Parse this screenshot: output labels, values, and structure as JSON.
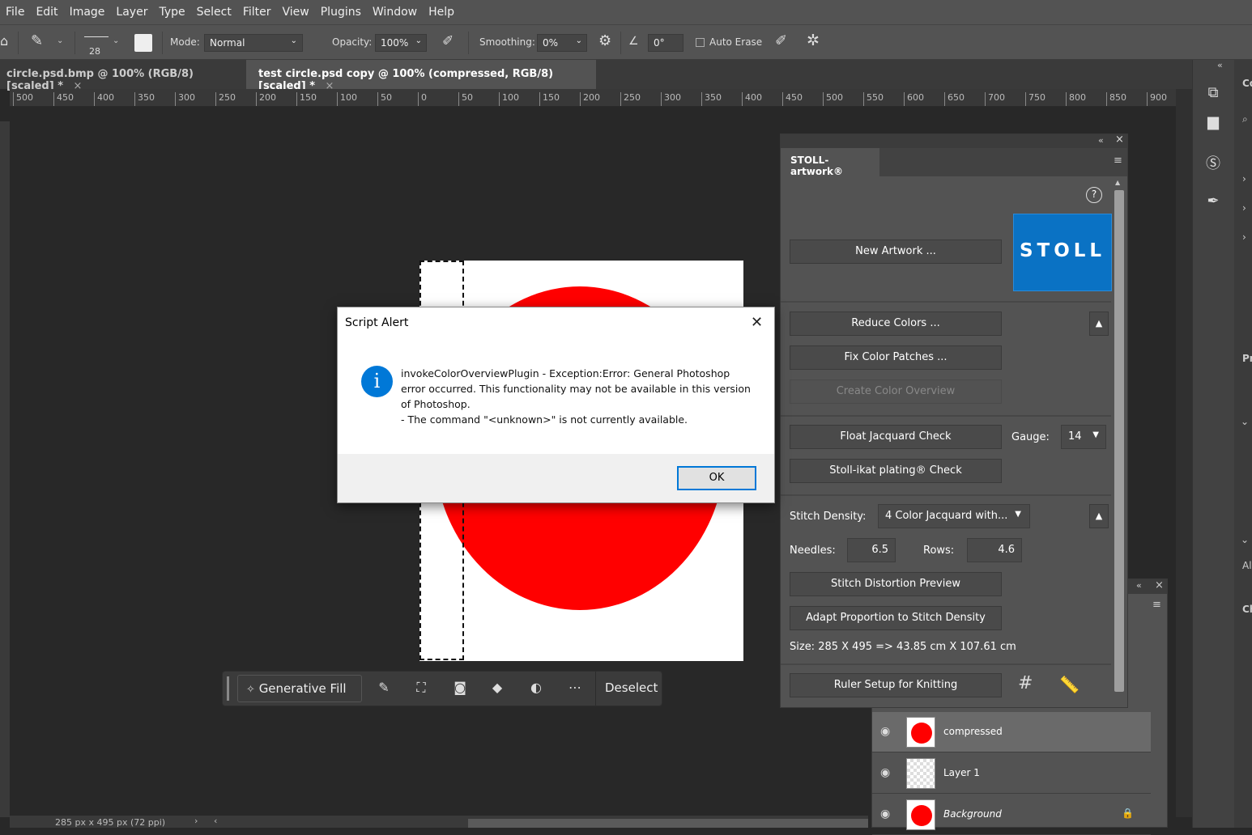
{
  "menu": [
    "File",
    "Edit",
    "Image",
    "Layer",
    "Type",
    "Select",
    "Filter",
    "View",
    "Plugins",
    "Window",
    "Help"
  ],
  "options": {
    "brush_size": "28",
    "mode_label": "Mode:",
    "mode_value": "Normal",
    "opacity_label": "Opacity:",
    "opacity_value": "100%",
    "smoothing_label": "Smoothing:",
    "smoothing_value": "0%",
    "angle_value": "0°",
    "auto_erase_label": "Auto Erase"
  },
  "tabs": [
    {
      "label": "circle.psd.bmp @ 100% (RGB/8) [scaled] *",
      "active": false
    },
    {
      "label": "test circle.psd copy @ 100% (compressed, RGB/8) [scaled] *",
      "active": true
    }
  ],
  "ruler_ticks": [
    "500",
    "450",
    "400",
    "350",
    "300",
    "250",
    "200",
    "150",
    "100",
    "50",
    "0",
    "50",
    "100",
    "150",
    "200",
    "250",
    "300",
    "350",
    "400",
    "450",
    "500",
    "550",
    "600",
    "650",
    "700",
    "750",
    "800",
    "850",
    "900"
  ],
  "context_bar": {
    "generative_fill": "Generative Fill",
    "deselect": "Deselect"
  },
  "status": "285 px x 495 px (72 ppi)",
  "stoll": {
    "panel_title": "STOLL-artwork®",
    "logo_text": "STOLL",
    "new_artwork": "New Artwork ...",
    "reduce_colors": "Reduce Colors ...",
    "fix_color_patches": "Fix Color Patches ...",
    "create_color_overview": "Create Color Overview",
    "float_jacquard_check": "Float Jacquard Check",
    "gauge_label": "Gauge:",
    "gauge_value": "14",
    "ikat_check": "Stoll-ikat plating® Check",
    "stitch_density_label": "Stitch Density:",
    "stitch_density_value": "4 Color Jacquard with...",
    "needles_label": "Needles:",
    "needles_value": "6.5",
    "rows_label": "Rows:",
    "rows_value": "4.6",
    "stitch_distortion_preview": "Stitch Distortion Preview",
    "adapt_proportion": "Adapt Proportion to Stitch Density",
    "size_text": "Size: 285 X 495 => 43.85 cm X 107.61 cm",
    "ruler_setup": "Ruler Setup for Knitting"
  },
  "layers": [
    {
      "name": "compressed",
      "selected": true,
      "thumb": "red"
    },
    {
      "name": "Layer 1",
      "selected": false,
      "thumb": "transparent"
    },
    {
      "name": "Background",
      "selected": false,
      "thumb": "red",
      "locked": true
    }
  ],
  "dialog": {
    "title": "Script Alert",
    "message_lines": [
      "invokeColorOverviewPlugin - Exception:Error: General Photoshop",
      "error occurred. This functionality may not be available in this version",
      "of Photoshop.",
      "- The command \"<unknown>\" is not currently available."
    ],
    "ok": "OK"
  },
  "colors": {
    "accent": "#0078d7",
    "stoll_blue": "#0a72c4",
    "circle_red": "#ff0000"
  }
}
